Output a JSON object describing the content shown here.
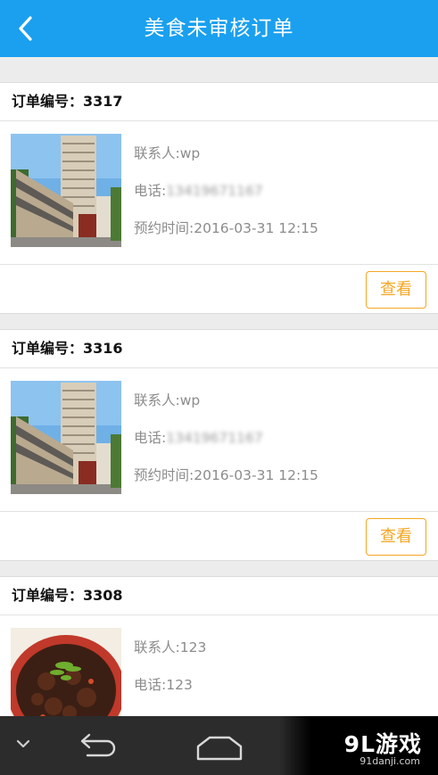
{
  "header": {
    "title": "美食未审核订单",
    "back_icon": "chevron-left-icon"
  },
  "orders": [
    {
      "order_label": "订单编号：3317",
      "contact": "联系人:wp",
      "phone_prefix": "电话:",
      "phone_value": "13419671167",
      "time": "预约时间:2016-03-31 12:15",
      "image": "building-photo",
      "view_label": "查看"
    },
    {
      "order_label": "订单编号：3316",
      "contact": "联系人:wp",
      "phone_prefix": "电话:",
      "phone_value": "13419671167",
      "time": "预约时间:2016-03-31 12:15",
      "image": "building-photo",
      "view_label": "查看"
    },
    {
      "order_label": "订单编号：3308",
      "contact": "联系人:123",
      "phone_prefix": "电话:",
      "phone_value": "123",
      "image": "food-photo"
    }
  ],
  "navbar": {
    "icons": [
      "chevron-down-icon",
      "back-arrow-icon",
      "home-icon"
    ]
  },
  "watermark": {
    "logo": "9L游戏",
    "site": "91danji.com"
  },
  "colors": {
    "header": "#1aa0ef",
    "accent": "#f5a623"
  }
}
